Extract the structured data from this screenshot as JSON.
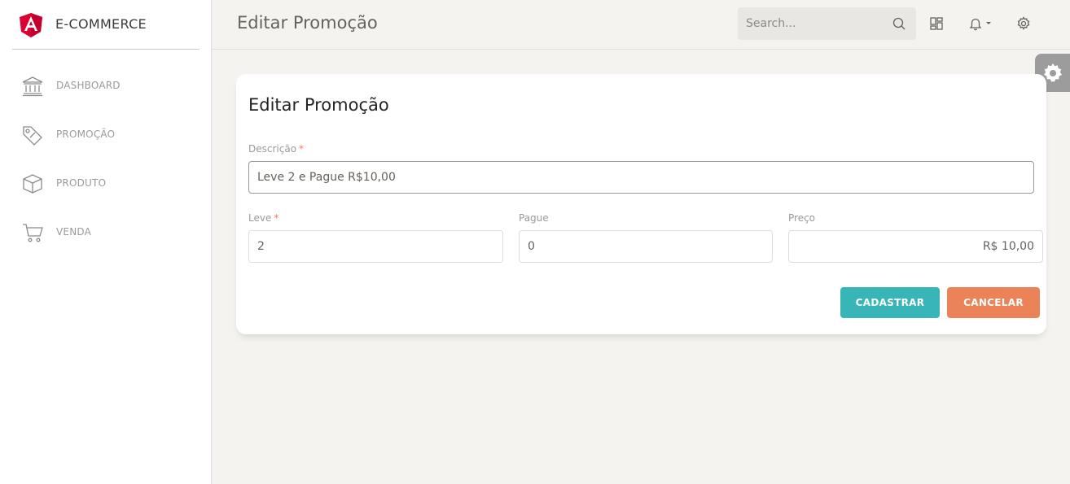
{
  "brand": {
    "name": "E-COMMERCE",
    "logo_icon": "angular-logo-icon",
    "logo_color": "#dd0031"
  },
  "sidebar": {
    "items": [
      {
        "label": "DASHBOARD",
        "icon": "bank-icon"
      },
      {
        "label": "PROMOÇÃO",
        "icon": "tag-icon"
      },
      {
        "label": "PRODUTO",
        "icon": "box-icon"
      },
      {
        "label": "VENDA",
        "icon": "cart-icon"
      }
    ]
  },
  "header": {
    "title": "Editar Promoção",
    "search": {
      "placeholder": "Search...",
      "value": ""
    },
    "icons": [
      "search-icon",
      "dashboard-layout-icon",
      "bell-icon",
      "gear-icon"
    ]
  },
  "form": {
    "title": "Editar Promoção",
    "descricao": {
      "label": "Descrição",
      "required_mark": "*",
      "value": "Leve 2 e Pague R$10,00"
    },
    "leve": {
      "label": "Leve",
      "required_mark": "*",
      "value": "2"
    },
    "pague": {
      "label": "Pague",
      "value": "0"
    },
    "preco": {
      "label": "Preço",
      "value": "R$ 10,00"
    },
    "submit_label": "CADASTRAR",
    "cancel_label": "CANCELAR"
  },
  "colors": {
    "primary": "#38b6b7",
    "warning": "#ec8358",
    "background": "#f4f3ef",
    "required": "#ef8157"
  }
}
